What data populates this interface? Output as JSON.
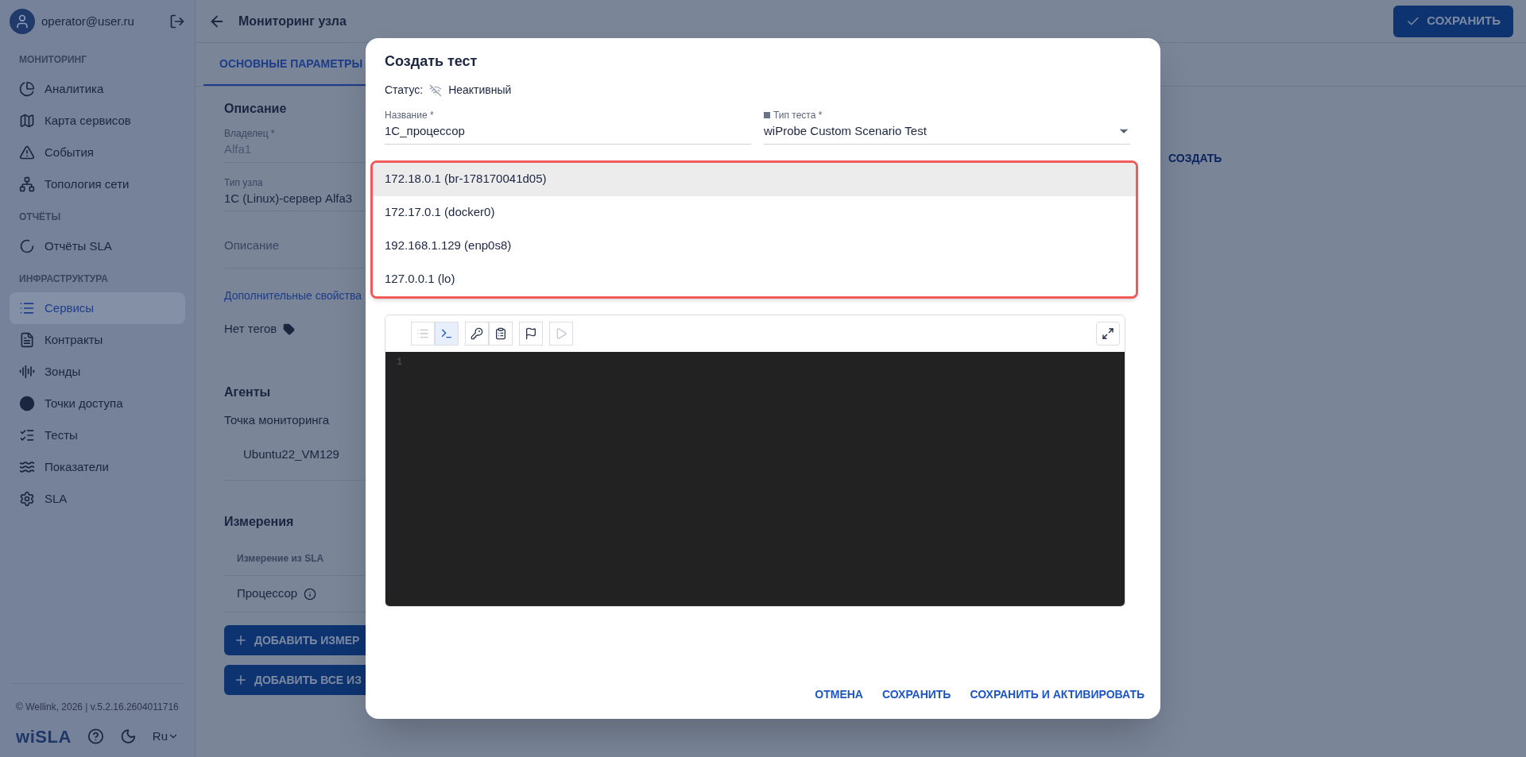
{
  "sidebar": {
    "user": "operator@user.ru",
    "sections": [
      {
        "title": "МОНИТОРИНГ",
        "items": [
          {
            "label": "Аналитика",
            "kind": "pie",
            "selected": false
          },
          {
            "label": "Карта сервисов",
            "kind": "map",
            "selected": false
          },
          {
            "label": "События",
            "kind": "warning",
            "selected": false
          },
          {
            "label": "Топология сети",
            "kind": "topology",
            "selected": false
          }
        ]
      },
      {
        "title": "ОТЧЁТЫ",
        "items": [
          {
            "label": "Отчёты SLA",
            "kind": "ring",
            "selected": false
          }
        ]
      },
      {
        "title": "ИНФРАСТРУКТУРА",
        "items": [
          {
            "label": "Сервисы",
            "kind": "list",
            "selected": true
          },
          {
            "label": "Контракты",
            "kind": "document",
            "selected": false
          },
          {
            "label": "Зонды",
            "kind": "wave",
            "selected": false
          },
          {
            "label": "Точки доступа",
            "kind": "dot",
            "selected": false
          },
          {
            "label": "Тесты",
            "kind": "checklist",
            "selected": false
          },
          {
            "label": "Показатели",
            "kind": "lines",
            "selected": false
          },
          {
            "label": "SLA",
            "kind": "gear",
            "selected": false
          }
        ]
      }
    ],
    "copyright": "© Wellink, 2026 | v.5.2.16.2604011716",
    "logo": "wiSLA",
    "language": "Ru"
  },
  "header": {
    "title": "Мониторинг узла",
    "save_button": "СОХРАНИТЬ"
  },
  "tabs": [
    {
      "label": "ОСНОВНЫЕ ПАРАМЕТРЫ",
      "selected": true
    }
  ],
  "description": {
    "title": "Описание",
    "fields": [
      {
        "label": "Владелец *",
        "value": "Alfa1",
        "disabled": true
      },
      {
        "label": "Тип узла",
        "value": "1C (Linux)-сервер Alfa3",
        "disabled": false
      }
    ],
    "description_placeholder": "Описание",
    "extra_link": "Дополнительные свойства",
    "tags": "Нет тегов"
  },
  "agents": {
    "title": "Агенты",
    "label": "Точка мониторинга",
    "items": [
      "Ubuntu22_VM129"
    ]
  },
  "measurements": {
    "title": "Измерения",
    "column": "Измерение из SLA",
    "rows": [
      "Процессор"
    ],
    "buttons": [
      "ДОБАВИТЬ ИЗМЕР",
      "ДОБАВИТЬ ВСЕ ИЗ"
    ]
  },
  "create_link": "СОЗДАТЬ",
  "modal": {
    "title": "Создать тест",
    "status_label": "Статус:",
    "status_value": "Неактивный",
    "name": {
      "label": "Название *",
      "value": "1C_процессор"
    },
    "test_type": {
      "label": "Тип теста *",
      "value": "wiProbe Custom Scenario Test"
    },
    "interface_options": [
      {
        "label": "172.18.0.1 (br-178170041d05)",
        "selected": true
      },
      {
        "label": "172.17.0.1 (docker0)",
        "selected": false
      },
      {
        "label": "192.168.1.129 (enp0s8)",
        "selected": false
      },
      {
        "label": "127.0.0.1 (lo)",
        "selected": false
      }
    ],
    "tools": [
      {
        "kind": "list",
        "selected": false,
        "disabled": true
      },
      {
        "kind": "terminal",
        "selected": true,
        "disabled": false
      },
      {
        "kind": "key",
        "selected": false,
        "disabled": false
      },
      {
        "kind": "clipboard",
        "selected": false,
        "disabled": false
      },
      {
        "kind": "flag",
        "selected": false,
        "disabled": false
      },
      {
        "kind": "play",
        "selected": false,
        "disabled": true
      }
    ],
    "line_numbers": [
      "1"
    ],
    "buttons": [
      "ОТМЕНА",
      "СОХРАНИТЬ",
      "СОХРАНИТЬ И АКТИВИРОВАТЬ"
    ]
  }
}
